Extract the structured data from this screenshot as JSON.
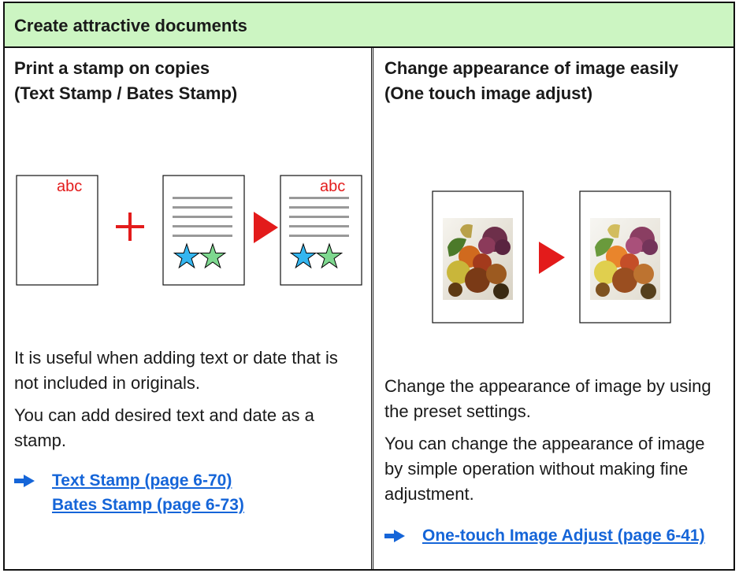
{
  "header": {
    "title": "Create attractive documents"
  },
  "left": {
    "title": "Print a stamp on copies\n(Text Stamp / Bates Stamp)",
    "stamp_text": "abc",
    "paragraphs": [
      "It is useful when adding text or date that is not included in originals.",
      "You can add desired text and date as a stamp."
    ],
    "links": [
      "Text Stamp (page 6-70)",
      "Bates Stamp (page 6-73)"
    ]
  },
  "right": {
    "title": "Change appearance of image easily\n(One touch image adjust)",
    "paragraphs": [
      "Change the appearance of image by using the preset settings.",
      "You can change the appearance of image by simple operation without making fine adjustment."
    ],
    "links": [
      "One-touch Image Adjust (page 6-41)"
    ]
  },
  "colors": {
    "header_bg": "#ccf5c2",
    "link": "#1565d8",
    "accent_red": "#e31b1b",
    "star_blue": "#34b6f0",
    "star_green": "#7ed88f",
    "arrow_blue": "#1565d8"
  },
  "icons": [
    "plus-icon",
    "play-arrow-icon",
    "star-icon",
    "link-arrow-icon"
  ]
}
